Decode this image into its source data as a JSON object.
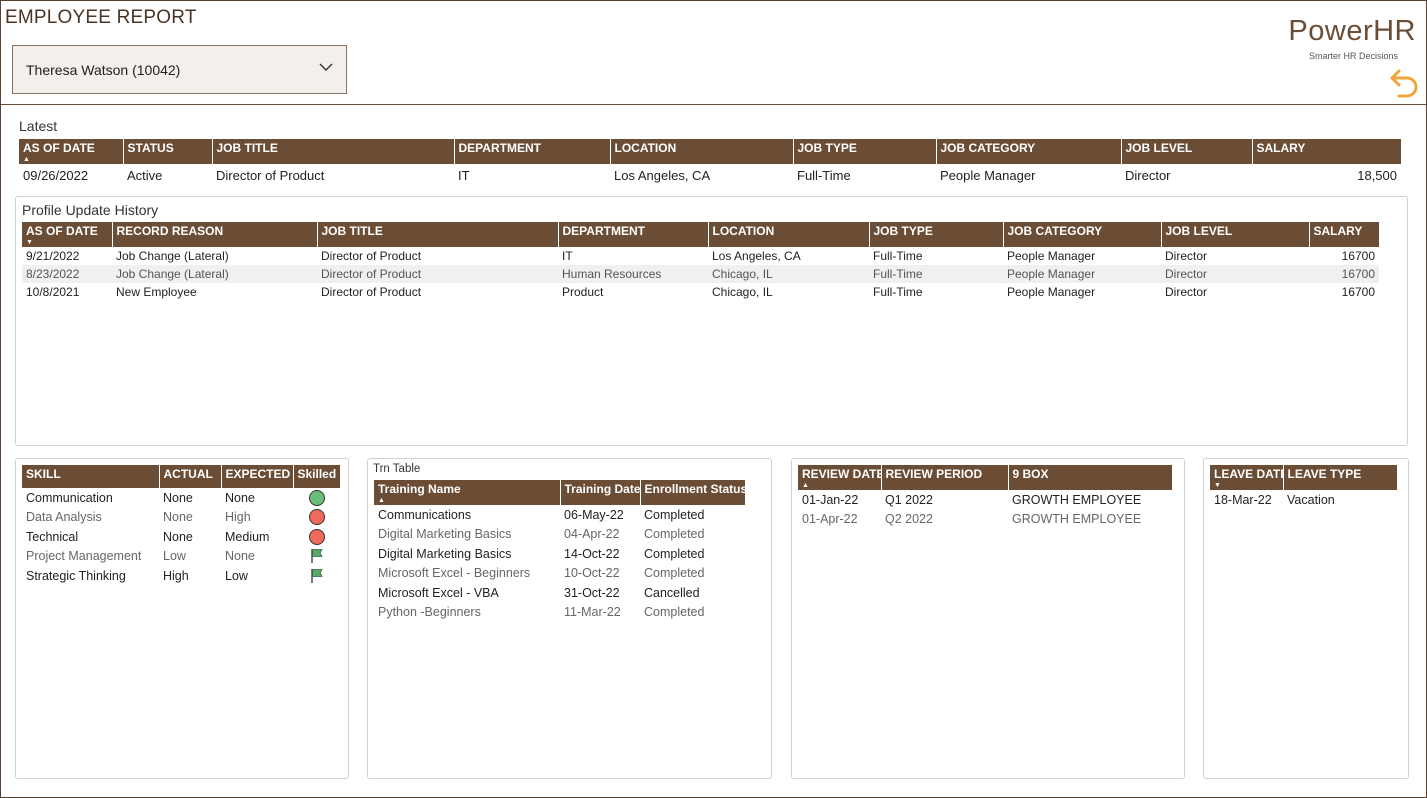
{
  "header": {
    "title": "EMPLOYEE REPORT",
    "employee_selected": "Theresa Watson (10042)",
    "brand_name": "PowerHR",
    "brand_tagline": "Smarter HR Decisions"
  },
  "latest": {
    "label": "Latest",
    "columns": [
      "AS OF DATE",
      "STATUS",
      "JOB TITLE",
      "DEPARTMENT",
      "LOCATION",
      "JOB TYPE",
      "JOB CATEGORY",
      "JOB LEVEL",
      "SALARY"
    ],
    "row": [
      "09/26/2022",
      "Active",
      "Director of Product",
      "IT",
      "Los Angeles, CA",
      "Full-Time",
      "People Manager",
      "Director",
      "18,500"
    ]
  },
  "history": {
    "label": "Profile Update History",
    "columns": [
      "AS OF DATE",
      "RECORD REASON",
      "JOB TITLE",
      "DEPARTMENT",
      "LOCATION",
      "JOB TYPE",
      "JOB CATEGORY",
      "JOB LEVEL",
      "SALARY"
    ],
    "rows": [
      [
        "9/21/2022",
        "Job Change (Lateral)",
        "Director of Product",
        "IT",
        "Los Angeles, CA",
        "Full-Time",
        "People Manager",
        "Director",
        "16700"
      ],
      [
        "8/23/2022",
        "Job Change (Lateral)",
        "Director of Product",
        "Human Resources",
        "Chicago, IL",
        "Full-Time",
        "People Manager",
        "Director",
        "16700"
      ],
      [
        "10/8/2021",
        "New Employee",
        "Director of Product",
        "Product",
        "Chicago, IL",
        "Full-Time",
        "People Manager",
        "Director",
        "16700"
      ]
    ]
  },
  "skills": {
    "columns": [
      "SKILL",
      "ACTUAL",
      "EXPECTED",
      "Skilled"
    ],
    "rows": [
      {
        "skill": "Communication",
        "actual": "None",
        "expected": "None",
        "indicator": "green-circle-icon"
      },
      {
        "skill": "Data Analysis",
        "actual": "None",
        "expected": "High",
        "indicator": "red-circle-icon"
      },
      {
        "skill": "Technical",
        "actual": "None",
        "expected": "Medium",
        "indicator": "red-circle-icon"
      },
      {
        "skill": "Project Management",
        "actual": "Low",
        "expected": "None",
        "indicator": "green-flag-icon"
      },
      {
        "skill": "Strategic Thinking",
        "actual": "High",
        "expected": "Low",
        "indicator": "green-flag-icon"
      }
    ]
  },
  "training": {
    "label": "Trn Table",
    "columns": [
      "Training Name",
      "Training Date",
      "Enrollment Status"
    ],
    "rows": [
      [
        "Communications",
        "06-May-22",
        "Completed"
      ],
      [
        "Digital Marketing Basics",
        "04-Apr-22",
        "Completed"
      ],
      [
        "Digital Marketing Basics",
        "14-Oct-22",
        "Completed"
      ],
      [
        "Microsoft Excel - Beginners",
        "10-Oct-22",
        "Completed"
      ],
      [
        "Microsoft Excel - VBA",
        "31-Oct-22",
        "Cancelled"
      ],
      [
        "Python -Beginners",
        "11-Mar-22",
        "Completed"
      ]
    ]
  },
  "reviews": {
    "columns": [
      "REVIEW DATE",
      "REVIEW PERIOD",
      "9 BOX"
    ],
    "rows": [
      [
        "01-Jan-22",
        "Q1 2022",
        "GROWTH EMPLOYEE"
      ],
      [
        "01-Apr-22",
        "Q2 2022",
        "GROWTH EMPLOYEE"
      ]
    ]
  },
  "leave": {
    "columns": [
      "LEAVE DATE",
      "LEAVE TYPE"
    ],
    "rows": [
      [
        "18-Mar-22",
        "Vacation"
      ]
    ]
  },
  "colors": {
    "header_brown": "#6b4d36",
    "status_green": "#6bbd7a",
    "status_red": "#ef6a5d",
    "accent_orange": "#f0a53a"
  }
}
